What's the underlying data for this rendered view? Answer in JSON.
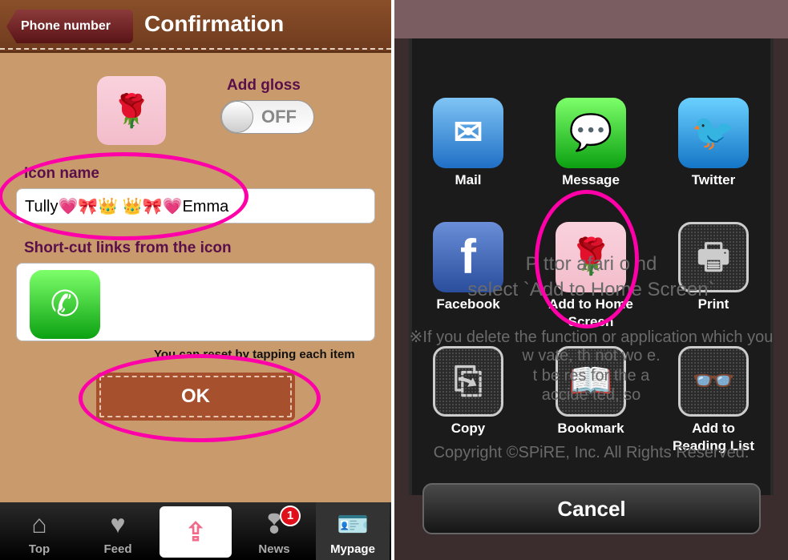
{
  "left": {
    "back_label": "Phone number",
    "title": "Confirmation",
    "add_gloss_label": "Add gloss",
    "toggle_state": "OFF",
    "icon_name_label": "Icon name",
    "icon_name_value": "Tully💗🎀👑 👑🎀💗Emma",
    "shortcut_label": "Short-cut links from the icon",
    "reset_hint": "You can reset by tapping each item",
    "ok_label": "OK",
    "tabs": [
      {
        "label": "Top",
        "icon": "house-icon"
      },
      {
        "label": "Feed",
        "icon": "heart-icon"
      },
      {
        "label": "",
        "icon": "upload-photo-icon"
      },
      {
        "label": "News",
        "icon": "speech-bubble-icon",
        "badge": "1"
      },
      {
        "label": "Mypage",
        "icon": "id-card-icon"
      }
    ],
    "highlight_color": "#ff00a8"
  },
  "right": {
    "bg_lines": [
      "P ttor afari o nd",
      "select `Add to Home Screen`",
      "※If you delete the function or application which you",
      "w vate, th not wo e.",
      "t be res for the a",
      "accide ted, so",
      "Copyright ©SPiRE, Inc. All Rights Reserved."
    ],
    "apps": [
      {
        "label": "Mail",
        "icon": "mail-icon"
      },
      {
        "label": "Message",
        "icon": "message-icon"
      },
      {
        "label": "Twitter",
        "icon": "twitter-icon"
      },
      {
        "label": "Facebook",
        "icon": "facebook-icon"
      },
      {
        "label": "Add to Home Screen",
        "icon": "add-to-home-icon"
      },
      {
        "label": "Print",
        "icon": "printer-icon"
      },
      {
        "label": "Copy",
        "icon": "copy-icon"
      },
      {
        "label": "Bookmark",
        "icon": "bookmark-icon"
      },
      {
        "label": "Add to Reading List",
        "icon": "glasses-icon"
      }
    ],
    "cancel_label": "Cancel"
  }
}
